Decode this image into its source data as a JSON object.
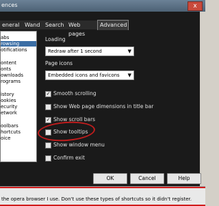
{
  "window": {
    "title": "ences",
    "close_label": "x"
  },
  "tabs": [
    {
      "label": "eneral"
    },
    {
      "label": "Wand"
    },
    {
      "label": "Search"
    },
    {
      "label": "Web pages"
    },
    {
      "label": "Advanced"
    }
  ],
  "sidebar": {
    "items": [
      {
        "label": "abs"
      },
      {
        "label": "rowsing"
      },
      {
        "label": "otifications"
      },
      {
        "label": ""
      },
      {
        "label": "ontent"
      },
      {
        "label": "onts"
      },
      {
        "label": "ownloads"
      },
      {
        "label": "rograms"
      },
      {
        "label": ""
      },
      {
        "label": "istory"
      },
      {
        "label": "ookies"
      },
      {
        "label": "ecurity"
      },
      {
        "label": "etwork"
      },
      {
        "label": ""
      },
      {
        "label": "oolbars"
      },
      {
        "label": "hortcuts"
      },
      {
        "label": "oice"
      }
    ]
  },
  "panel": {
    "loading_label": "Loading",
    "loading_value": "Redraw after 1 second",
    "page_icons_label": "Page icons",
    "page_icons_value": "Embedded icons and favicons",
    "options": [
      {
        "label": "Smooth scrolling",
        "checked": "✓"
      },
      {
        "label": "Show Web page dimensions in title bar",
        "checked": ""
      },
      {
        "label": "Show scroll bars",
        "checked": "✓"
      },
      {
        "label": "Show tooltips",
        "checked": ""
      },
      {
        "label": "Show window menu",
        "checked": ""
      },
      {
        "label": "Confirm exit",
        "checked": ""
      }
    ]
  },
  "buttons": {
    "ok": "OK",
    "cancel": "Cancel",
    "help": "Help"
  },
  "status": {
    "message": "the opera browser I use. Don't use these types of shortcuts so it didn't register."
  }
}
